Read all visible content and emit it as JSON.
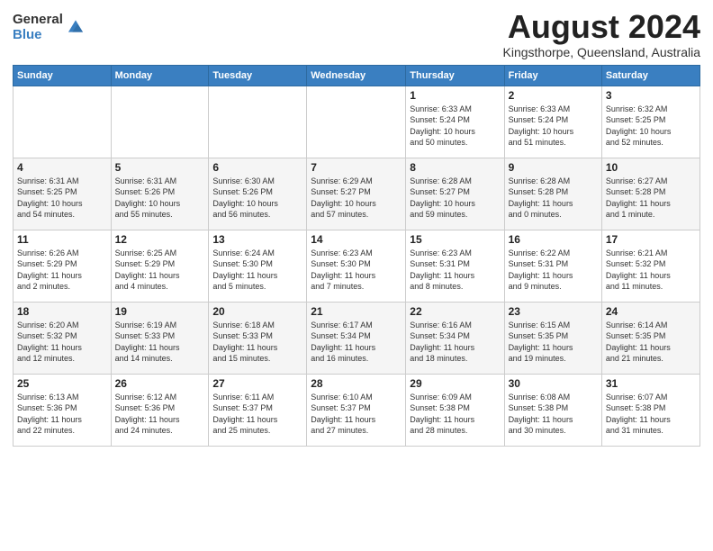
{
  "logo": {
    "general": "General",
    "blue": "Blue"
  },
  "header": {
    "month": "August 2024",
    "location": "Kingsthorpe, Queensland, Australia"
  },
  "days_of_week": [
    "Sunday",
    "Monday",
    "Tuesday",
    "Wednesday",
    "Thursday",
    "Friday",
    "Saturday"
  ],
  "weeks": [
    [
      {
        "day": "",
        "info": ""
      },
      {
        "day": "",
        "info": ""
      },
      {
        "day": "",
        "info": ""
      },
      {
        "day": "",
        "info": ""
      },
      {
        "day": "1",
        "info": "Sunrise: 6:33 AM\nSunset: 5:24 PM\nDaylight: 10 hours\nand 50 minutes."
      },
      {
        "day": "2",
        "info": "Sunrise: 6:33 AM\nSunset: 5:24 PM\nDaylight: 10 hours\nand 51 minutes."
      },
      {
        "day": "3",
        "info": "Sunrise: 6:32 AM\nSunset: 5:25 PM\nDaylight: 10 hours\nand 52 minutes."
      }
    ],
    [
      {
        "day": "4",
        "info": "Sunrise: 6:31 AM\nSunset: 5:25 PM\nDaylight: 10 hours\nand 54 minutes."
      },
      {
        "day": "5",
        "info": "Sunrise: 6:31 AM\nSunset: 5:26 PM\nDaylight: 10 hours\nand 55 minutes."
      },
      {
        "day": "6",
        "info": "Sunrise: 6:30 AM\nSunset: 5:26 PM\nDaylight: 10 hours\nand 56 minutes."
      },
      {
        "day": "7",
        "info": "Sunrise: 6:29 AM\nSunset: 5:27 PM\nDaylight: 10 hours\nand 57 minutes."
      },
      {
        "day": "8",
        "info": "Sunrise: 6:28 AM\nSunset: 5:27 PM\nDaylight: 10 hours\nand 59 minutes."
      },
      {
        "day": "9",
        "info": "Sunrise: 6:28 AM\nSunset: 5:28 PM\nDaylight: 11 hours\nand 0 minutes."
      },
      {
        "day": "10",
        "info": "Sunrise: 6:27 AM\nSunset: 5:28 PM\nDaylight: 11 hours\nand 1 minute."
      }
    ],
    [
      {
        "day": "11",
        "info": "Sunrise: 6:26 AM\nSunset: 5:29 PM\nDaylight: 11 hours\nand 2 minutes."
      },
      {
        "day": "12",
        "info": "Sunrise: 6:25 AM\nSunset: 5:29 PM\nDaylight: 11 hours\nand 4 minutes."
      },
      {
        "day": "13",
        "info": "Sunrise: 6:24 AM\nSunset: 5:30 PM\nDaylight: 11 hours\nand 5 minutes."
      },
      {
        "day": "14",
        "info": "Sunrise: 6:23 AM\nSunset: 5:30 PM\nDaylight: 11 hours\nand 7 minutes."
      },
      {
        "day": "15",
        "info": "Sunrise: 6:23 AM\nSunset: 5:31 PM\nDaylight: 11 hours\nand 8 minutes."
      },
      {
        "day": "16",
        "info": "Sunrise: 6:22 AM\nSunset: 5:31 PM\nDaylight: 11 hours\nand 9 minutes."
      },
      {
        "day": "17",
        "info": "Sunrise: 6:21 AM\nSunset: 5:32 PM\nDaylight: 11 hours\nand 11 minutes."
      }
    ],
    [
      {
        "day": "18",
        "info": "Sunrise: 6:20 AM\nSunset: 5:32 PM\nDaylight: 11 hours\nand 12 minutes."
      },
      {
        "day": "19",
        "info": "Sunrise: 6:19 AM\nSunset: 5:33 PM\nDaylight: 11 hours\nand 14 minutes."
      },
      {
        "day": "20",
        "info": "Sunrise: 6:18 AM\nSunset: 5:33 PM\nDaylight: 11 hours\nand 15 minutes."
      },
      {
        "day": "21",
        "info": "Sunrise: 6:17 AM\nSunset: 5:34 PM\nDaylight: 11 hours\nand 16 minutes."
      },
      {
        "day": "22",
        "info": "Sunrise: 6:16 AM\nSunset: 5:34 PM\nDaylight: 11 hours\nand 18 minutes."
      },
      {
        "day": "23",
        "info": "Sunrise: 6:15 AM\nSunset: 5:35 PM\nDaylight: 11 hours\nand 19 minutes."
      },
      {
        "day": "24",
        "info": "Sunrise: 6:14 AM\nSunset: 5:35 PM\nDaylight: 11 hours\nand 21 minutes."
      }
    ],
    [
      {
        "day": "25",
        "info": "Sunrise: 6:13 AM\nSunset: 5:36 PM\nDaylight: 11 hours\nand 22 minutes."
      },
      {
        "day": "26",
        "info": "Sunrise: 6:12 AM\nSunset: 5:36 PM\nDaylight: 11 hours\nand 24 minutes."
      },
      {
        "day": "27",
        "info": "Sunrise: 6:11 AM\nSunset: 5:37 PM\nDaylight: 11 hours\nand 25 minutes."
      },
      {
        "day": "28",
        "info": "Sunrise: 6:10 AM\nSunset: 5:37 PM\nDaylight: 11 hours\nand 27 minutes."
      },
      {
        "day": "29",
        "info": "Sunrise: 6:09 AM\nSunset: 5:38 PM\nDaylight: 11 hours\nand 28 minutes."
      },
      {
        "day": "30",
        "info": "Sunrise: 6:08 AM\nSunset: 5:38 PM\nDaylight: 11 hours\nand 30 minutes."
      },
      {
        "day": "31",
        "info": "Sunrise: 6:07 AM\nSunset: 5:38 PM\nDaylight: 11 hours\nand 31 minutes."
      }
    ]
  ]
}
